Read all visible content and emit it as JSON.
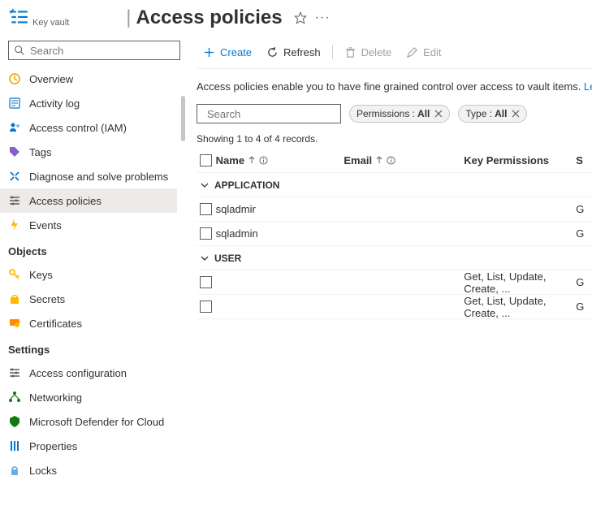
{
  "breadcrumb": "Key vault",
  "page_title": "Access policies",
  "sidebar": {
    "search_placeholder": "Search",
    "items_top": [
      {
        "id": "overview",
        "label": "Overview"
      },
      {
        "id": "activitylog",
        "label": "Activity log"
      },
      {
        "id": "iam",
        "label": "Access control (IAM)"
      },
      {
        "id": "tags",
        "label": "Tags"
      },
      {
        "id": "diagnose",
        "label": "Diagnose and solve problems"
      },
      {
        "id": "accesspolicies",
        "label": "Access policies"
      },
      {
        "id": "events",
        "label": "Events"
      }
    ],
    "section_objects": "Objects",
    "items_objects": [
      {
        "id": "keys",
        "label": "Keys"
      },
      {
        "id": "secrets",
        "label": "Secrets"
      },
      {
        "id": "certificates",
        "label": "Certificates"
      }
    ],
    "section_settings": "Settings",
    "items_settings": [
      {
        "id": "accessconfig",
        "label": "Access configuration"
      },
      {
        "id": "networking",
        "label": "Networking"
      },
      {
        "id": "defender",
        "label": "Microsoft Defender for Cloud"
      },
      {
        "id": "properties",
        "label": "Properties"
      },
      {
        "id": "locks",
        "label": "Locks"
      }
    ]
  },
  "commands": {
    "create": "Create",
    "refresh": "Refresh",
    "delete": "Delete",
    "edit": "Edit"
  },
  "description_text": "Access policies enable you to have fine grained control over access to vault items. ",
  "description_link": "Learn more",
  "filters": {
    "search_placeholder": "Search",
    "perm_label": "Permissions : ",
    "perm_value": "All",
    "type_label": "Type : ",
    "type_value": "All"
  },
  "records_text": "Showing 1 to 4 of 4 records.",
  "columns": {
    "name": "Name",
    "email": "Email",
    "keyperm": "Key Permissions",
    "s": "S"
  },
  "groups": [
    {
      "label": "APPLICATION",
      "rows": [
        {
          "name": "sqladmir",
          "email": "",
          "keyperm": "",
          "s": "G"
        },
        {
          "name": "sqladmin",
          "email": "",
          "keyperm": "",
          "s": "G"
        }
      ]
    },
    {
      "label": "USER",
      "rows": [
        {
          "name": "",
          "email": "",
          "keyperm": "Get, List, Update, Create, ...",
          "s": "G"
        },
        {
          "name": "",
          "email": "",
          "keyperm": "Get, List, Update, Create, ...",
          "s": "G"
        }
      ]
    }
  ]
}
